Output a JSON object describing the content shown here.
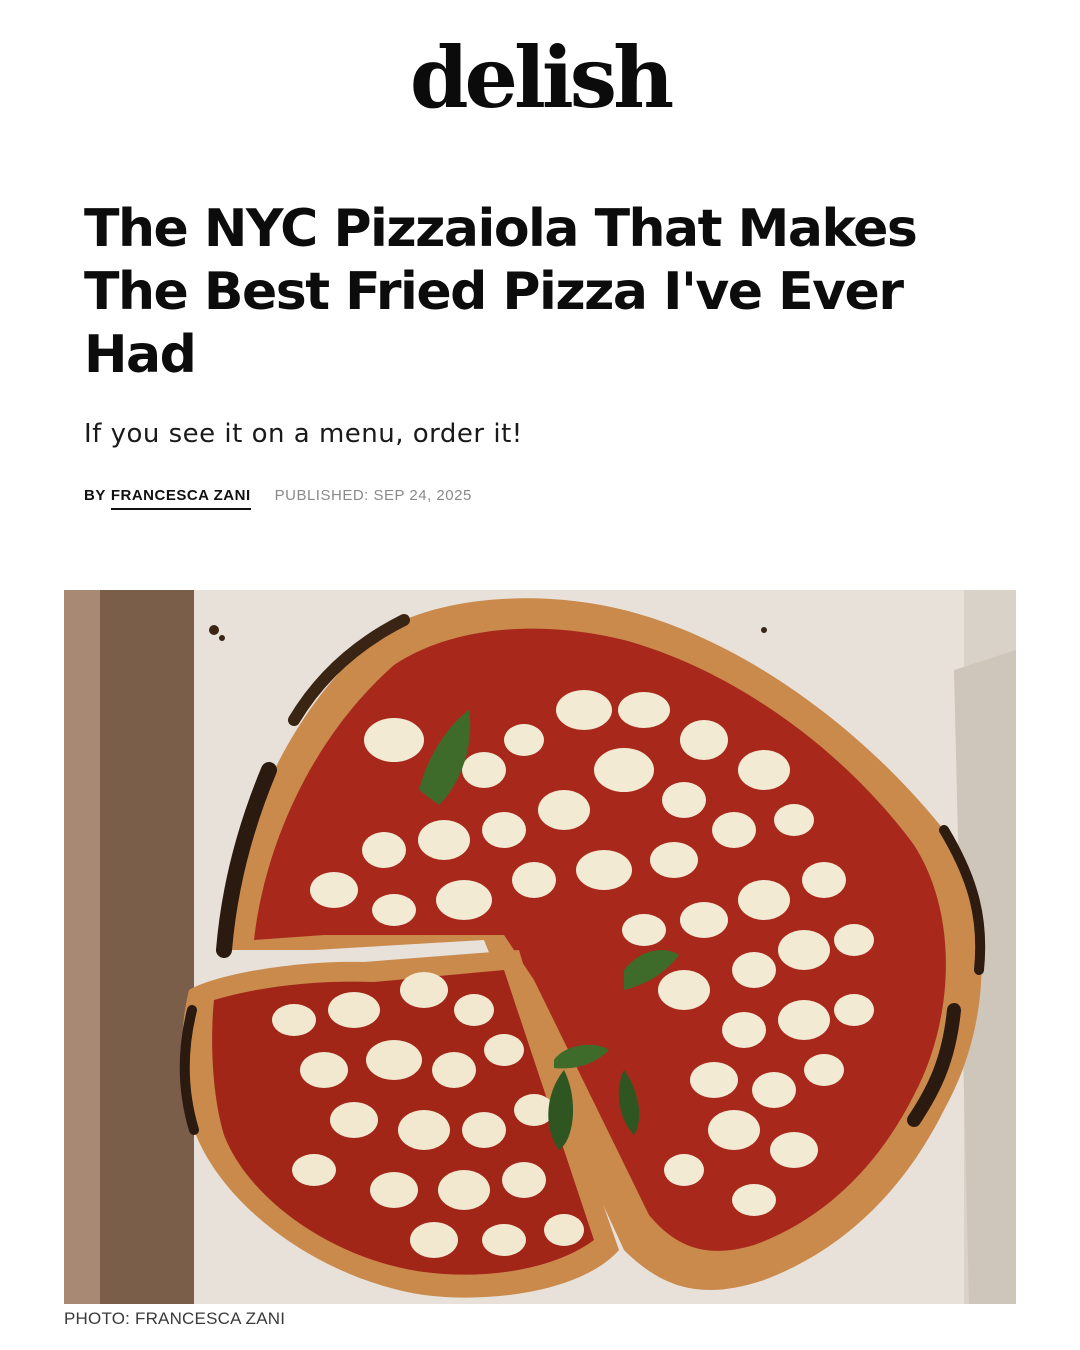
{
  "site": {
    "logo_text": "delish"
  },
  "article": {
    "headline": "The NYC Pizzaiola That Makes The Best Fried Pizza I've Ever Had",
    "dek": "If you see it on a menu, order it!",
    "byline": {
      "prefix": "BY",
      "author": "FRANCESCA ZANI",
      "published": "PUBLISHED: SEP 24, 2025"
    },
    "hero_image": {
      "subject": "fried margherita pizza with tomato sauce, mozzarella and basil in a cardboard pizza box",
      "credit": "PHOTO: FRANCESCA ZANI"
    }
  },
  "colors": {
    "text": "#111111",
    "meta_gray": "#8a8a8a",
    "background": "#ffffff",
    "sauce": "#a8291c",
    "crust": "#c9874a",
    "char": "#2a1a10",
    "cheese": "#f3ead4",
    "basil": "#3e6b2a",
    "box": "#8c6e58",
    "paper": "#e6e0d8"
  }
}
